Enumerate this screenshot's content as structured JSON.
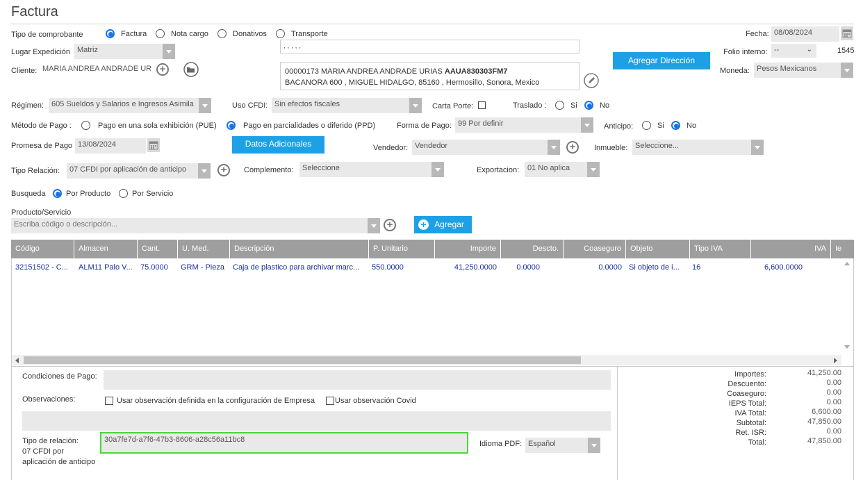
{
  "title": "Factura",
  "tipo_comprobante": {
    "label": "Tipo de comprobante",
    "options": [
      "Factura",
      "Nota cargo",
      "Donativos",
      "Transporte"
    ]
  },
  "fecha": {
    "label": "Fecha:",
    "value": "08/08/2024"
  },
  "folio": {
    "label": "Folio interno:",
    "select_value": "--",
    "number": "1545"
  },
  "lugar": {
    "label": "Lugar Expedición",
    "value": "Matriz"
  },
  "direccion_top": ", , , , ,",
  "agregar_direccion": "Agregar Dirección",
  "moneda": {
    "label": "Moneda:",
    "value": "Pesos Mexicanos"
  },
  "cliente": {
    "label": "Cliente:",
    "value": "MARIA ANDREA ANDRADE URI",
    "info_line1": "00000173 MARIA ANDREA ANDRADE URIAS",
    "info_rfc": "AAUA830303FM7",
    "info_line2": "BACANORA 600 , MIGUEL HIDALGO, 85160 , Hermosillo, Sonora, Mexico"
  },
  "regimen": {
    "label": "Régimen:",
    "value": "605 Sueldos y Salarios e Ingresos Asimila"
  },
  "uso_cfdi": {
    "label": "Uso CFDI:",
    "value": "Sin efectos fiscales"
  },
  "carta_porte": {
    "label": "Carta Porte:"
  },
  "traslado": {
    "label": "Traslado :",
    "si": "Si",
    "no": "No"
  },
  "metodo_pago": {
    "label": "Método de Pago :",
    "opt1": "Pago en una sola exhibición (PUE)",
    "opt2": "Pago en parcialidades o diferido (PPD)"
  },
  "forma_pago": {
    "label": "Forma de Pago:",
    "value": "99  Por definir"
  },
  "anticipo": {
    "label": "Anticipo:",
    "si": "Si",
    "no": "No"
  },
  "promesa": {
    "label": "Promesa de Pago",
    "value": "13/08/2024"
  },
  "datos_adicionales": "Datos Adicionales",
  "vendedor": {
    "label": "Vendedor:",
    "value": "Vendedor"
  },
  "inmueble": {
    "label": "Inmueble:",
    "value": "Seleccione..."
  },
  "tipo_relacion": {
    "label": "Tipo Relación:",
    "value": "07 CFDI por aplicación de anticipo"
  },
  "complemento": {
    "label": "Complemento:",
    "value": "Seleccione"
  },
  "exportacion": {
    "label": "Exportacion:",
    "value": "01 No aplica"
  },
  "busqueda": {
    "label": "Busqueda",
    "opt1": "Por Producto",
    "opt2": "Por Servicio"
  },
  "producto": {
    "label": "Producto/Servicio",
    "placeholder": "Escriba código o descripción..."
  },
  "agregar": "Agregar",
  "grid": {
    "headers": [
      "Código",
      "Almacen",
      "Cant.",
      "U. Med.",
      "Descripción",
      "P. Unitario",
      "Importe",
      "Descto.",
      "Coaseguro",
      "Objeto",
      "Tipo IVA",
      "IVA",
      "Ie"
    ],
    "rows": [
      [
        "32151502 - C...",
        "ALM11 Palo V...",
        "75.0000",
        "GRM - Pieza",
        "Caja de plastico para archivar marc...",
        "550.0000",
        "41,250.0000",
        "0.0000",
        "0.0000",
        "Si objeto de i...",
        "16",
        "6,600.0000",
        ""
      ]
    ]
  },
  "condiciones": {
    "label": "Condiciones de Pago:"
  },
  "observaciones": {
    "label": "Observaciones:",
    "check1": "Usar observación definida en la configuración de Empresa",
    "check2": "Usar observación Covid"
  },
  "relacion_bottom": {
    "label1": "Tipo de relación:",
    "label2": "07 CFDI por",
    "label3": "aplicación de anticipo",
    "uuid": "30a7fe7d-a7f6-47b3-8606-a28c56a11bc8"
  },
  "idioma": {
    "label": "Idioma PDF:",
    "value": "Español"
  },
  "totales": [
    {
      "label": "Importes:",
      "value": "41,250.00"
    },
    {
      "label": "Descuento:",
      "value": "0.00"
    },
    {
      "label": "Coaseguro:",
      "value": "0.00"
    },
    {
      "label": "IEPS Total:",
      "value": "0.00"
    },
    {
      "label": "IVA Total:",
      "value": "6,600.00"
    },
    {
      "label": "Subtotal:",
      "value": "47,850.00"
    },
    {
      "label": "Ret. ISR:",
      "value": "0.00"
    },
    {
      "label": "Total:",
      "value": "47,850.00"
    }
  ]
}
